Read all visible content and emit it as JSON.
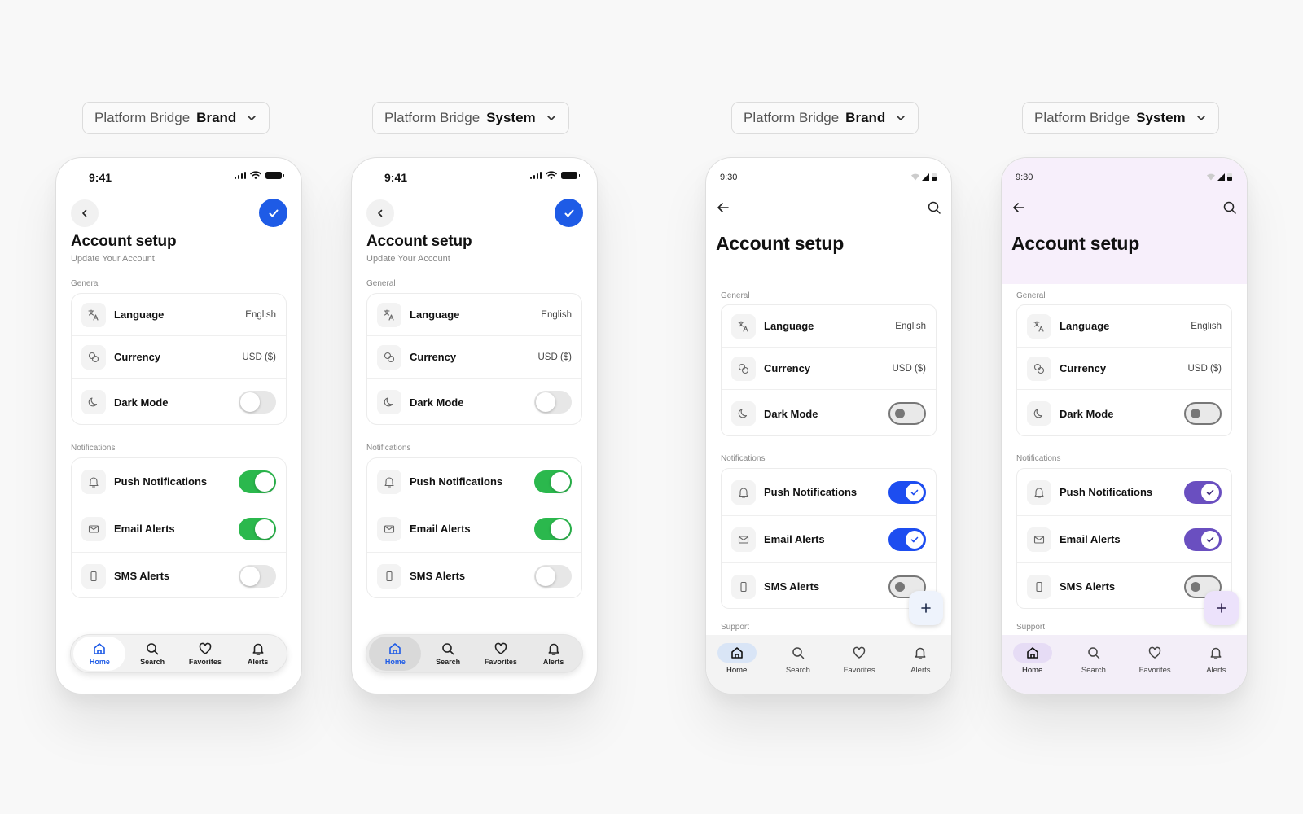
{
  "selectors": [
    {
      "name": "Platform Bridge",
      "value": "Brand"
    },
    {
      "name": "Platform Bridge",
      "value": "System"
    },
    {
      "name": "Platform Bridge",
      "value": "Brand"
    },
    {
      "name": "Platform Bridge",
      "value": "System"
    }
  ],
  "phones": [
    {
      "time": "9:41",
      "title": "Account setup",
      "subtitle": "Update Your Account",
      "general_label": "General",
      "notifications_label": "Notifications",
      "general": [
        {
          "label": "Language",
          "value": "English",
          "icon": "translate-icon"
        },
        {
          "label": "Currency",
          "value": "USD ($)",
          "icon": "coins-icon"
        },
        {
          "label": "Dark Mode",
          "toggle": false,
          "icon": "moon-icon"
        }
      ],
      "notifications": [
        {
          "label": "Push Notifications",
          "toggle": true,
          "icon": "bell-icon"
        },
        {
          "label": "Email Alerts",
          "toggle": true,
          "icon": "mail-icon"
        },
        {
          "label": "SMS Alerts",
          "toggle": false,
          "icon": "phone-icon"
        }
      ],
      "tabs": [
        "Home",
        "Search",
        "Favorites",
        "Alerts"
      ],
      "active_tab": "Home"
    },
    {
      "time": "9:41",
      "title": "Account setup",
      "subtitle": "Update Your Account",
      "general_label": "General",
      "notifications_label": "Notifications",
      "general": [
        {
          "label": "Language",
          "value": "English",
          "icon": "translate-icon"
        },
        {
          "label": "Currency",
          "value": "USD ($)",
          "icon": "coins-icon"
        },
        {
          "label": "Dark Mode",
          "toggle": false,
          "icon": "moon-icon"
        }
      ],
      "notifications": [
        {
          "label": "Push Notifications",
          "toggle": true,
          "icon": "bell-icon"
        },
        {
          "label": "Email Alerts",
          "toggle": true,
          "icon": "mail-icon"
        },
        {
          "label": "SMS Alerts",
          "toggle": false,
          "icon": "phone-icon"
        }
      ],
      "tabs": [
        "Home",
        "Search",
        "Favorites",
        "Alerts"
      ],
      "active_tab": "Home"
    },
    {
      "time": "9:30",
      "title": "Account setup",
      "general_label": "General",
      "notifications_label": "Notifications",
      "support_label": "Support",
      "general": [
        {
          "label": "Language",
          "value": "English",
          "icon": "translate-icon"
        },
        {
          "label": "Currency",
          "value": "USD ($)",
          "icon": "coins-icon"
        },
        {
          "label": "Dark Mode",
          "toggle": false,
          "icon": "moon-icon"
        }
      ],
      "notifications": [
        {
          "label": "Push Notifications",
          "toggle": true,
          "icon": "bell-icon"
        },
        {
          "label": "Email Alerts",
          "toggle": true,
          "icon": "mail-icon"
        },
        {
          "label": "SMS Alerts",
          "toggle": false,
          "icon": "phone-icon"
        }
      ],
      "tabs": [
        "Home",
        "Search",
        "Favorites",
        "Alerts"
      ],
      "active_tab": "Home"
    },
    {
      "time": "9:30",
      "title": "Account setup",
      "general_label": "General",
      "notifications_label": "Notifications",
      "support_label": "Support",
      "general": [
        {
          "label": "Language",
          "value": "English",
          "icon": "translate-icon"
        },
        {
          "label": "Currency",
          "value": "USD ($)",
          "icon": "coins-icon"
        },
        {
          "label": "Dark Mode",
          "toggle": false,
          "icon": "moon-icon"
        }
      ],
      "notifications": [
        {
          "label": "Push Notifications",
          "toggle": true,
          "icon": "bell-icon"
        },
        {
          "label": "Email Alerts",
          "toggle": true,
          "icon": "mail-icon"
        },
        {
          "label": "SMS Alerts",
          "toggle": false,
          "icon": "phone-icon"
        }
      ],
      "tabs": [
        "Home",
        "Search",
        "Favorites",
        "Alerts"
      ],
      "active_tab": "Home"
    }
  ],
  "colors": {
    "ios_accent": "#1e5be6",
    "ios_toggle_on": "#2bb84d",
    "android_brand_toggle": "#1d4df0",
    "android_system_toggle": "#6a4fc0",
    "android_system_header": "#f7effb"
  }
}
